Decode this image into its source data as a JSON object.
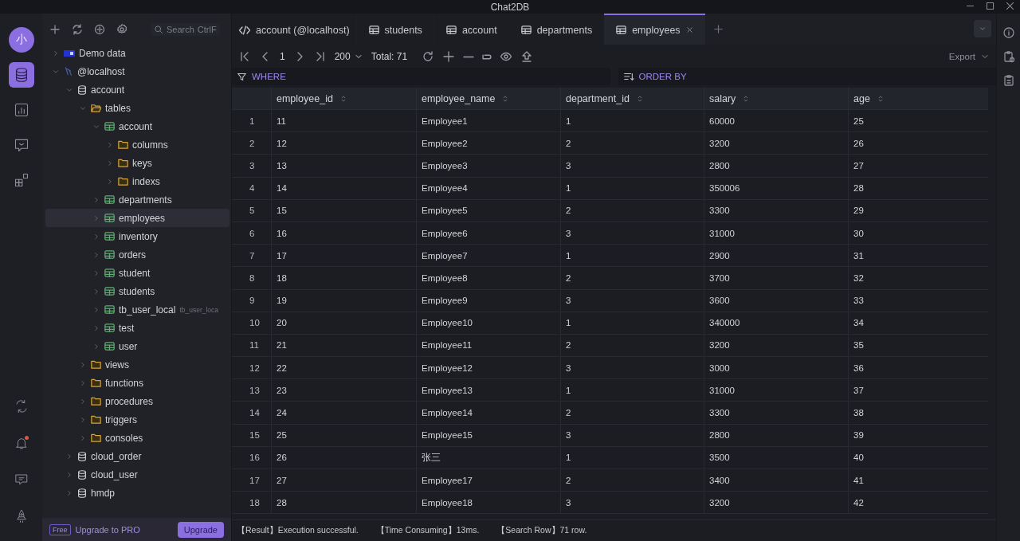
{
  "window": {
    "title": "Chat2DB"
  },
  "rail": {
    "logo": "小",
    "items": [
      {
        "selected": true
      },
      {
        "selected": false
      },
      {
        "selected": false
      },
      {
        "selected": false
      }
    ],
    "bell_badge": true
  },
  "sidebar": {
    "search": {
      "placeholder": "Search",
      "shortcut": "CtrlF"
    },
    "tree": [
      {
        "kind": "demo",
        "label": "Demo data",
        "expanded": false,
        "selected": false
      },
      {
        "kind": "connection",
        "label": "@localhost",
        "expanded": true,
        "selected": false,
        "children": [
          {
            "kind": "database",
            "label": "account",
            "expanded": true,
            "selected": false,
            "children": [
              {
                "kind": "folder",
                "label": "tables",
                "expanded": true,
                "selected": false,
                "children": [
                  {
                    "kind": "table",
                    "label": "account",
                    "expanded": true,
                    "selected": false,
                    "children": [
                      {
                        "kind": "folder",
                        "label": "columns",
                        "expanded": false,
                        "selected": false
                      },
                      {
                        "kind": "folder",
                        "label": "keys",
                        "expanded": false,
                        "selected": false
                      },
                      {
                        "kind": "folder",
                        "label": "indexs",
                        "expanded": false,
                        "selected": false
                      }
                    ]
                  },
                  {
                    "kind": "table",
                    "label": "departments",
                    "expanded": false,
                    "selected": false
                  },
                  {
                    "kind": "table",
                    "label": "employees",
                    "expanded": false,
                    "selected": true
                  },
                  {
                    "kind": "table",
                    "label": "inventory",
                    "expanded": false,
                    "selected": false
                  },
                  {
                    "kind": "table",
                    "label": "orders",
                    "expanded": false,
                    "selected": false
                  },
                  {
                    "kind": "table",
                    "label": "student",
                    "expanded": false,
                    "selected": false
                  },
                  {
                    "kind": "table",
                    "label": "students",
                    "expanded": false,
                    "selected": false
                  },
                  {
                    "kind": "table",
                    "label": "tb_user_local",
                    "comment": "tb_user_loca",
                    "expanded": false,
                    "selected": false
                  },
                  {
                    "kind": "table",
                    "label": "test",
                    "expanded": false,
                    "selected": false
                  },
                  {
                    "kind": "table",
                    "label": "user",
                    "expanded": false,
                    "selected": false
                  }
                ]
              },
              {
                "kind": "folder",
                "label": "views",
                "expanded": false,
                "selected": false
              },
              {
                "kind": "folder",
                "label": "functions",
                "expanded": false,
                "selected": false
              },
              {
                "kind": "folder",
                "label": "procedures",
                "expanded": false,
                "selected": false
              },
              {
                "kind": "folder",
                "label": "triggers",
                "expanded": false,
                "selected": false
              },
              {
                "kind": "folder",
                "label": "consoles",
                "expanded": false,
                "selected": false
              }
            ]
          },
          {
            "kind": "database",
            "label": "cloud_order",
            "expanded": false,
            "selected": false
          },
          {
            "kind": "database",
            "label": "cloud_user",
            "expanded": false,
            "selected": false
          },
          {
            "kind": "database",
            "label": "hmdp",
            "expanded": false,
            "selected": false
          }
        ]
      }
    ],
    "upgrade": {
      "badge": "Free",
      "text": "Upgrade to PRO",
      "button": "Upgrade"
    }
  },
  "tabs": [
    {
      "kind": "console",
      "label": "account (@localhost)",
      "selected": false
    },
    {
      "kind": "table",
      "label": "students",
      "selected": false
    },
    {
      "kind": "table",
      "label": "account",
      "selected": false
    },
    {
      "kind": "table",
      "label": "departments",
      "selected": false
    },
    {
      "kind": "table",
      "label": "employees",
      "selected": true
    }
  ],
  "toolbar": {
    "page": "1",
    "page_size": "200",
    "total": "Total: 71",
    "export": "Export"
  },
  "filters": {
    "where": "WHERE",
    "order_by": "ORDER BY"
  },
  "table": {
    "columns": [
      "employee_id",
      "employee_name",
      "department_id",
      "salary",
      "age"
    ],
    "rows": [
      {
        "no": "1",
        "cells": [
          "11",
          "Employee1",
          "1",
          "60000",
          "25"
        ]
      },
      {
        "no": "2",
        "cells": [
          "12",
          "Employee2",
          "2",
          "3200",
          "26"
        ]
      },
      {
        "no": "3",
        "cells": [
          "13",
          "Employee3",
          "3",
          "2800",
          "27"
        ]
      },
      {
        "no": "4",
        "cells": [
          "14",
          "Employee4",
          "1",
          "350006",
          "28"
        ]
      },
      {
        "no": "5",
        "cells": [
          "15",
          "Employee5",
          "2",
          "3300",
          "29"
        ]
      },
      {
        "no": "6",
        "cells": [
          "16",
          "Employee6",
          "3",
          "31000",
          "30"
        ]
      },
      {
        "no": "7",
        "cells": [
          "17",
          "Employee7",
          "1",
          "2900",
          "31"
        ]
      },
      {
        "no": "8",
        "cells": [
          "18",
          "Employee8",
          "2",
          "3700",
          "32"
        ]
      },
      {
        "no": "9",
        "cells": [
          "19",
          "Employee9",
          "3",
          "3600",
          "33"
        ]
      },
      {
        "no": "10",
        "cells": [
          "20",
          "Employee10",
          "1",
          "340000",
          "34"
        ]
      },
      {
        "no": "11",
        "cells": [
          "21",
          "Employee11",
          "2",
          "3200",
          "35"
        ]
      },
      {
        "no": "12",
        "cells": [
          "22",
          "Employee12",
          "3",
          "3000",
          "36"
        ]
      },
      {
        "no": "13",
        "cells": [
          "23",
          "Employee13",
          "1",
          "31000",
          "37"
        ]
      },
      {
        "no": "14",
        "cells": [
          "24",
          "Employee14",
          "2",
          "3300",
          "38"
        ]
      },
      {
        "no": "15",
        "cells": [
          "25",
          "Employee15",
          "3",
          "2800",
          "39"
        ]
      },
      {
        "no": "16",
        "cells": [
          "26",
          "张三",
          "1",
          "3500",
          "40"
        ]
      },
      {
        "no": "17",
        "cells": [
          "27",
          "Employee17",
          "2",
          "3400",
          "41"
        ]
      },
      {
        "no": "18",
        "cells": [
          "28",
          "Employee18",
          "3",
          "3200",
          "42"
        ]
      }
    ]
  },
  "status_bar": [
    "【Result】Execution successful.",
    "【Time Consuming】13ms.",
    "【Search Row】71 row."
  ]
}
